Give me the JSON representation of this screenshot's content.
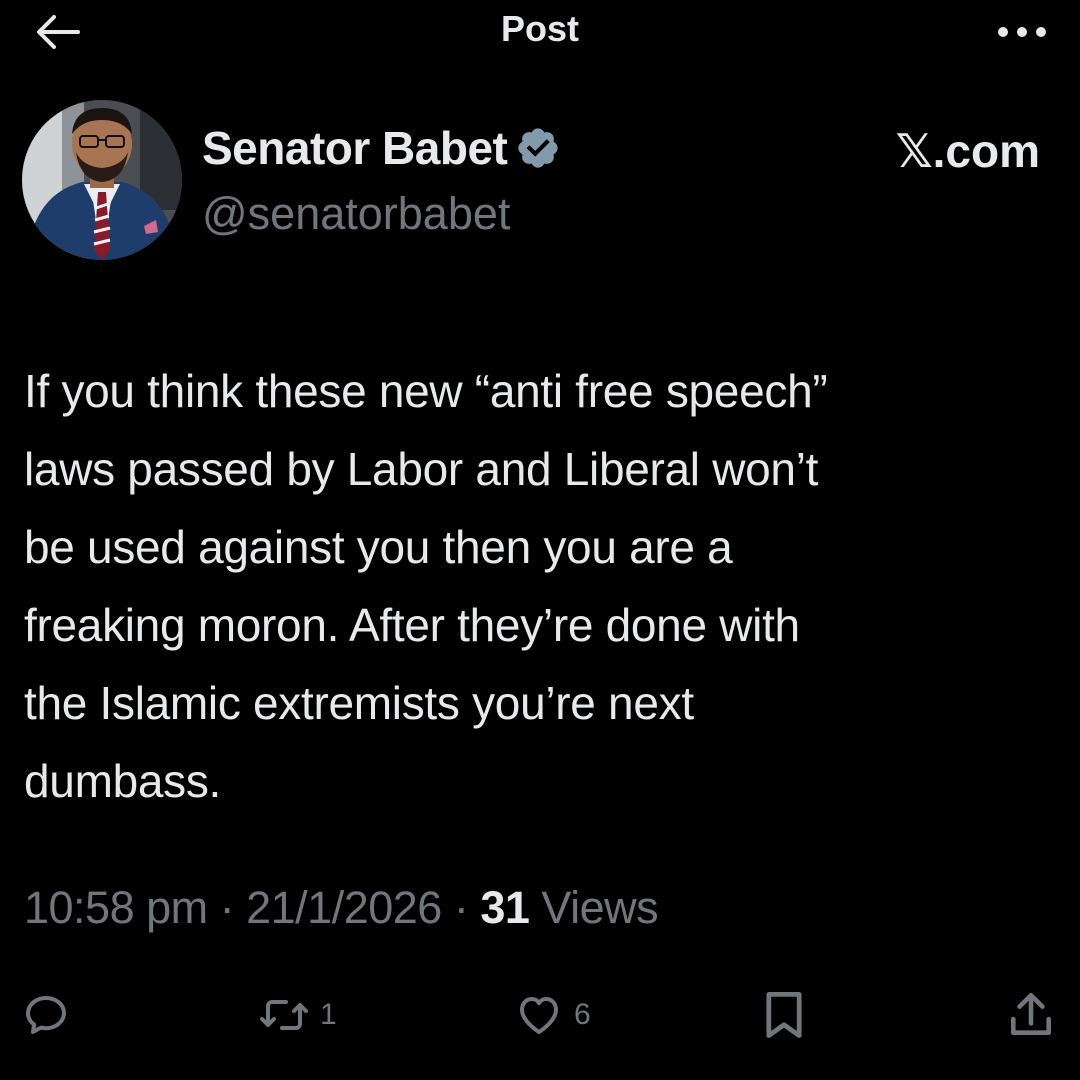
{
  "header": {
    "title": "Post",
    "back_icon": "arrow-left-icon",
    "more_icon": "more-horizontal-icon"
  },
  "author": {
    "display_name": "Senator Babet",
    "handle": "@senatorbabet",
    "verified_icon": "verified-badge-icon",
    "avatar": "profile-photo"
  },
  "source_label": "𝕏.com",
  "post": {
    "lines": [
      "If you think these new “anti free speech”",
      "laws passed by Labor and Liberal won’t",
      "be used against you then you are a",
      "freaking moron. After they’re done with",
      "the Islamic extremists you’re next",
      "dumbass."
    ]
  },
  "meta": {
    "time": "10:58 pm",
    "separator": " · ",
    "date": "21/1/2026",
    "views_count": "31",
    "views_label": " Views"
  },
  "actions": {
    "reply": {
      "icon": "reply-icon",
      "count": ""
    },
    "repost": {
      "icon": "repost-icon",
      "count": "1"
    },
    "like": {
      "icon": "heart-icon",
      "count": "6"
    },
    "bookmark": {
      "icon": "bookmark-icon",
      "count": ""
    },
    "share": {
      "icon": "share-icon",
      "count": ""
    }
  },
  "colors": {
    "background": "#000000",
    "primary_text": "#e7e9ea",
    "secondary_text": "#71767b",
    "verified_badge": "#829aab"
  }
}
